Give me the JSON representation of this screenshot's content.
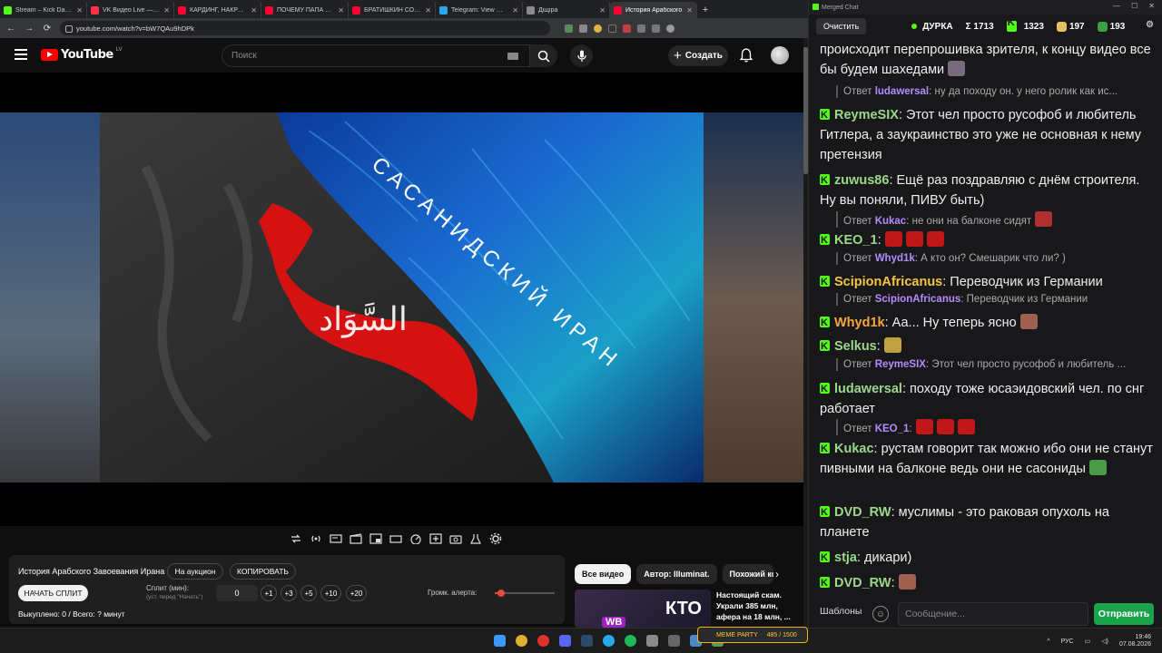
{
  "browser": {
    "tabs": [
      {
        "label": "Stream – Kick Dashboard",
        "color": "#53fc18"
      },
      {
        "label": "VK Видео Live — стриминг",
        "color": "#ff3347"
      },
      {
        "label": "КАРДИНГ, НАКРУТКА",
        "color": "#ff0033"
      },
      {
        "label": "ПОЧЕМУ ПАПА ТЕБЯ",
        "color": "#ff0033"
      },
      {
        "label": "БРАТИШКИН СОЗДАЛ",
        "color": "#ff0033"
      },
      {
        "label": "Telegram: View @good",
        "color": "#29a9eb"
      },
      {
        "label": "Дiщiра",
        "color": "#8a8a8a"
      },
      {
        "label": "История Арабского",
        "color": "#ff0033"
      }
    ],
    "new_tab": "+",
    "url": "youtube.com/watch?v=bW7QAu9hDPk",
    "win_minimize": "—",
    "win_maximize": "☐",
    "win_close": "✕",
    "nav_back": "←",
    "nav_forward": "→",
    "nav_reload": "⟳"
  },
  "youtube": {
    "logo_text": "YouTube",
    "region": "LV",
    "search_placeholder": "Поиск",
    "create_label": "Создать",
    "create_plus": "+"
  },
  "video": {
    "map_label_iran": "САСАНИДСКИЙ ИРАН",
    "map_label_arabic": "السَّوَاد"
  },
  "split_panel": {
    "title": "История Арабского Завоевания Ирана",
    "auction_label": "На аукцион",
    "copy_label": "КОПИРОВАТЬ",
    "start_label": "НАЧАТЬ СПЛИТ",
    "split_label": "Сплит (мин):",
    "split_hint": "(уст. перед \"Начать\")",
    "split_value": "0",
    "increments": [
      "+1",
      "+3",
      "+5",
      "+10",
      "+20"
    ],
    "volume_label": "Громк. алерта:",
    "volume_level": 0.1,
    "status": "Выкуплено: 0 / Всего: ? минут"
  },
  "recommendations": {
    "chips": [
      "Все видео",
      "Автор: Illuminat.",
      "Похожий ко"
    ],
    "chip_arrow": "›",
    "card_title": "Настоящий скам. Украли 385 млн, афера на 18 млн, ...",
    "thumb_text": "КТО",
    "thumb_sub": "WB"
  },
  "chat": {
    "window_title": "Merged Chat",
    "clear_label": "Очистить",
    "channel": "ДУРКА",
    "stat_sigma": "Σ 1713",
    "stat_kick": "1323",
    "stat_a": "197",
    "stat_b": "193",
    "partial_text": "происходит перепрошивка зрителя, к концу видео все бы будем шахедами",
    "messages": [
      {
        "type": "reply",
        "prefix": "Ответ",
        "user": "ludawersal",
        "text": ": ну да походу он. у него ролик как ис..."
      },
      {
        "type": "msg",
        "user": "ReymeSIX",
        "color": "#9bd88a",
        "text": ": Этот чел просто русофоб и любитель Гитлера, а заукраинство это уже не основная к нему претензия"
      },
      {
        "type": "msg",
        "user": "zuwus86",
        "color": "#9bd88a",
        "text": ": Ещё раз поздравляю с днём строителя. Ну вы поняли, ПИВУ быть)"
      },
      {
        "type": "reply",
        "prefix": "Ответ",
        "user": "Kukac",
        "text": ": не они на балконе сидят"
      },
      {
        "type": "msg",
        "user": "KEO_1",
        "color": "#9bd88a",
        "text": ":"
      },
      {
        "type": "reply",
        "prefix": "Ответ",
        "user": "Whyd1k",
        "text": ": А кто он? Смешарик что ли? )"
      },
      {
        "type": "msg",
        "user": "ScipionAfricanus",
        "color": "#f5c542",
        "text": ": Переводчик из Германии"
      },
      {
        "type": "reply",
        "prefix": "Ответ",
        "user": "ScipionAfricanus",
        "text": ": Переводчик из Германии"
      },
      {
        "type": "msg",
        "user": "Whyd1k",
        "color": "#f5a742",
        "text": ": Аа... Ну теперь ясно"
      },
      {
        "type": "msg",
        "user": "Selkus",
        "color": "#9bd88a",
        "text": ":"
      },
      {
        "type": "reply",
        "prefix": "Ответ",
        "user": "ReymeSIX",
        "text": ": Этот чел просто русофоб и любитель ..."
      },
      {
        "type": "msg",
        "user": "ludawersal",
        "color": "#9bd88a",
        "text": ": походу тоже юсаэидовский чел. по снг работает"
      },
      {
        "type": "reply",
        "prefix": "Ответ",
        "user": "KEO_1",
        "text": ":"
      },
      {
        "type": "msg",
        "user": "Kukac",
        "color": "#9bd88a",
        "text": ": рустам говорит так можно ибо они не станут пивными на балконе ведь они не сасониды"
      },
      {
        "type": "msg",
        "user": "DVD_RW",
        "color": "#9bd88a",
        "text": ": муслимы - это раковая опухоль на планете"
      },
      {
        "type": "msg",
        "user": "stja",
        "color": "#9bd88a",
        "text": ": дикари)"
      },
      {
        "type": "msg",
        "user": "DVD_RW",
        "color": "#9bd88a",
        "text": ":"
      }
    ],
    "templates_label": "Шаблоны",
    "input_placeholder": "Сообщение...",
    "send_label": "Отправить"
  },
  "taskbar": {
    "lang": "РУС",
    "time": "19:46",
    "date": "07.08.2026",
    "meme_label": "MEME PARTY",
    "meme_value": "485 / 1500"
  }
}
